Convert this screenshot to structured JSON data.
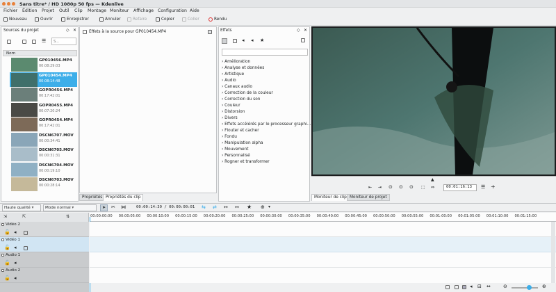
{
  "window": {
    "title": "Sans titre* / HD 1080p 50 fps — Kdenlive"
  },
  "menu": [
    "Fichier",
    "Édition",
    "Projet",
    "Outil",
    "Clip",
    "Montage",
    "Moniteur",
    "Affichage",
    "Configuration",
    "Aide"
  ],
  "toolbar": {
    "new": "Nouveau",
    "open": "Ouvrir",
    "save": "Enregistrer",
    "undo": "Annuler",
    "redo": "Refaire",
    "copy": "Copier",
    "paste": "Coller",
    "render": "Rendu"
  },
  "bin": {
    "title": "Sources du projet",
    "search_placeholder": "S...",
    "column": "Nom",
    "clips": [
      {
        "name": "GP010456.MP4",
        "duration": "00:08:29:03",
        "selected": false,
        "thumb": "#5b8a6f"
      },
      {
        "name": "GP010454.MP4",
        "duration": "00:08:14:48",
        "selected": true,
        "thumb": "#3f6f6a"
      },
      {
        "name": "GOPR0456.MP4",
        "duration": "00:17:42:01",
        "selected": false,
        "thumb": "#6b7f7a"
      },
      {
        "name": "GOPR0455.MP4",
        "duration": "00:07:20:24",
        "selected": false,
        "thumb": "#4a4a46"
      },
      {
        "name": "GOPR0454.MP4",
        "duration": "00:17:42:01",
        "selected": false,
        "thumb": "#7d6a58"
      },
      {
        "name": "DSCN6707.MOV",
        "duration": "00:00:34:41",
        "selected": false,
        "thumb": "#8aa6b8"
      },
      {
        "name": "DSCN6705.MOV",
        "duration": "00:00:31:31",
        "selected": false,
        "thumb": "#a9bdc9"
      },
      {
        "name": "DSCN6704.MOV",
        "duration": "00:00:19:10",
        "selected": false,
        "thumb": "#8fb0c4"
      },
      {
        "name": "DSCN6703.MOV",
        "duration": "00:00:28:14",
        "selected": false,
        "thumb": "#c5b99a"
      }
    ]
  },
  "properties": {
    "checkbox_label": "Effets à la source pour GP010454.MP4",
    "tabs": [
      "Propriétés",
      "Propriétés du clip"
    ]
  },
  "effects": {
    "title": "Effets",
    "categories": [
      "Amélioration",
      "Analyse et données",
      "Artistique",
      "Audio",
      "Canaux audio",
      "Correction de la couleur",
      "Correction du son",
      "Couleur",
      "Distorsion",
      "Divers",
      "Effets accélérés par le processeur graphi...",
      "Flouter et cacher",
      "Fondu",
      "Manipulation alpha",
      "Mouvement",
      "Personnalisé",
      "Rogner et transformer"
    ]
  },
  "monitor": {
    "timecode": "00:01:16:13",
    "tabs": [
      "Moniteur de clip",
      "Moniteur de projet"
    ]
  },
  "timeline": {
    "quality": "Haute qualité",
    "mode": "Mode normal",
    "timecode": "00:00:14:39 / 00:00:00:01",
    "ruler": [
      "00:00:00:00",
      "00:00:05:00",
      "00:00:10:00",
      "00:00:15:00",
      "00:00:20:00",
      "00:00:25:00",
      "00:00:30:00",
      "00:00:35:00",
      "00:00:40:00",
      "00:00:45:00",
      "00:00:50:00",
      "00:00:55:00",
      "00:01:00:00",
      "00:01:05:00",
      "00:01:10:00",
      "00:01:15:00"
    ],
    "tracks": [
      "Vidéo 2",
      "Vidéo 1",
      "Audio 1",
      "Audio 2"
    ]
  },
  "colors": {
    "accent": "#3daee9",
    "monitor_bg": "#1b1d1e",
    "track_active": "#e6f1f8"
  }
}
